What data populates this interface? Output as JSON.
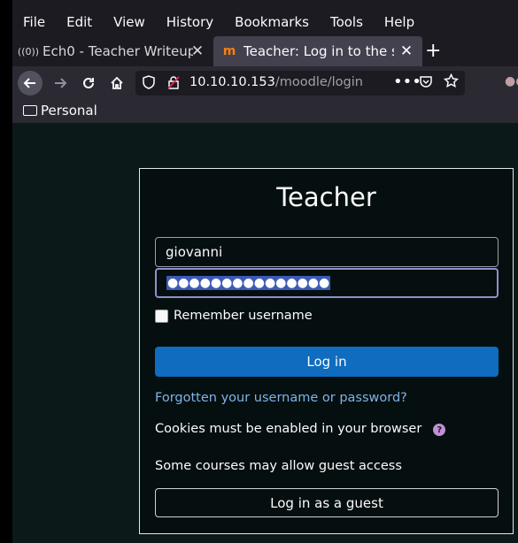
{
  "menu": [
    "File",
    "Edit",
    "View",
    "History",
    "Bookmarks",
    "Tools",
    "Help"
  ],
  "tabs": [
    {
      "icon": "((0))",
      "title": "Ech0 - Teacher Writeup",
      "close": "✕"
    },
    {
      "icon": "m",
      "title": "Teacher: Log in to the site",
      "close": "✕"
    }
  ],
  "new_tab": "+",
  "url": {
    "host": "10.10.10.153",
    "path": "/moodle/login"
  },
  "bookmark_folder": "Personal",
  "login": {
    "title": "Teacher",
    "username_value": "giovanni",
    "password_mask": "●●●●●●●●●●●●●●●",
    "remember_label": "Remember username",
    "login_button": "Log in",
    "forgot_link": "Forgotten your username or password?",
    "cookies_text": "Cookies must be enabled in your browser",
    "guest_text": "Some courses may allow guest access",
    "guest_button": "Log in as a guest"
  },
  "colors": {
    "accent": "#0f6cbf",
    "link": "#7fb3e8",
    "help": "#c08fd8"
  }
}
